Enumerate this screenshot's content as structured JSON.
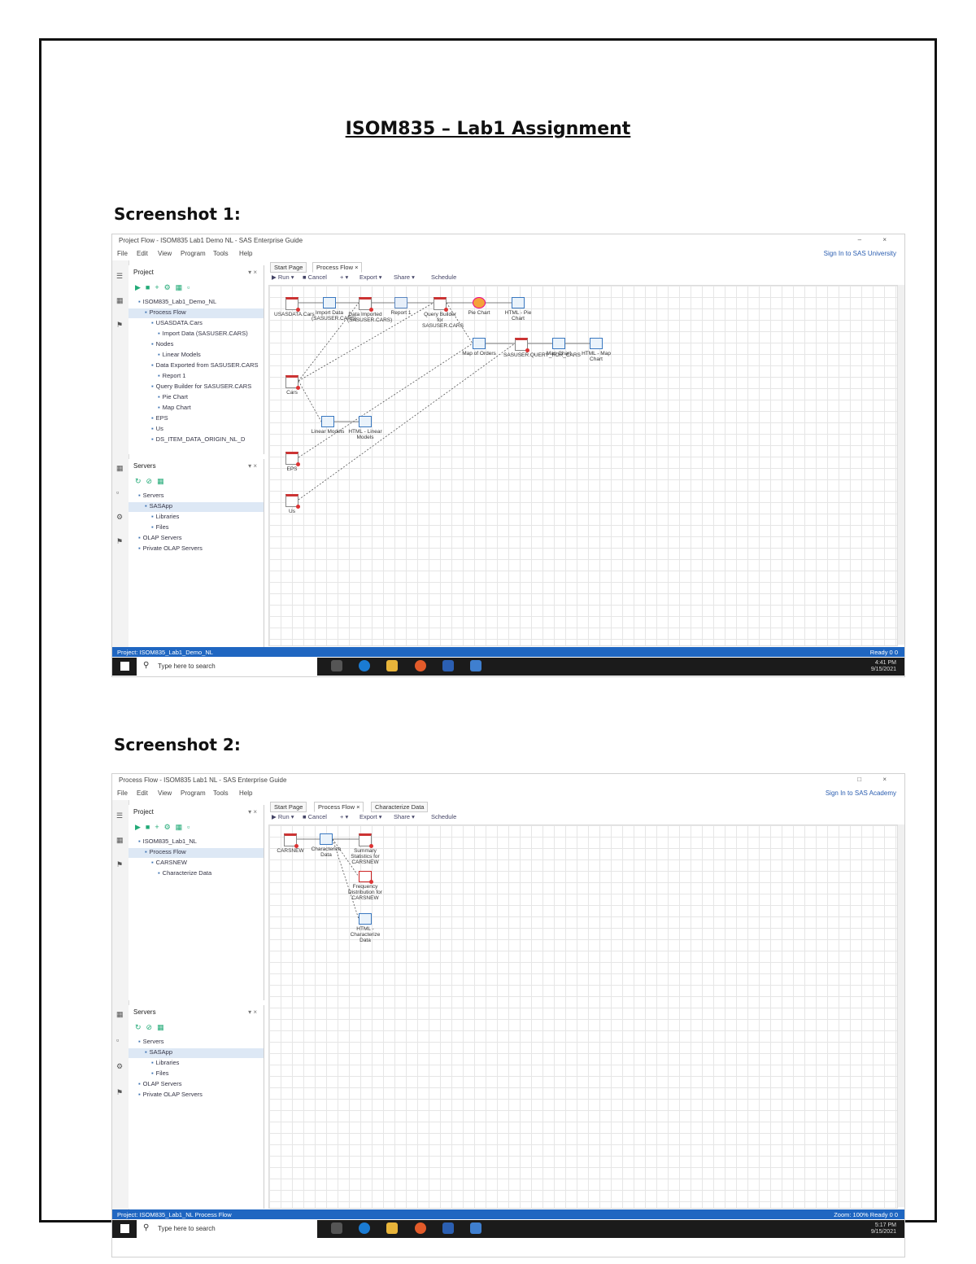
{
  "document": {
    "title": "ISOM835 – Lab1 Assignment",
    "captions": [
      "Screenshot 1:",
      "Screenshot 2:"
    ]
  },
  "shot1": {
    "window_title": "Project Flow - ISOM835 Lab1 Demo NL - SAS Enterprise Guide",
    "window_controls": "– ×",
    "menu": [
      "File",
      "Edit",
      "View",
      "Program",
      "Tools",
      "Help"
    ],
    "sign_in": "Sign In to SAS University",
    "project_panel": {
      "title": "Project",
      "close": "▾ ×"
    },
    "tree": [
      {
        "label": "ISOM835_Lab1_Demo_NL",
        "indent": 1
      },
      {
        "label": "Process Flow",
        "indent": 2,
        "selected": true
      },
      {
        "label": "USASDATA.Cars",
        "indent": 3
      },
      {
        "label": "Import Data (SASUSER.CARS)",
        "indent": 4
      },
      {
        "label": "Nodes",
        "indent": 3
      },
      {
        "label": "Linear Models",
        "indent": 4
      },
      {
        "label": "Data Exported from SASUSER.CARS",
        "indent": 3
      },
      {
        "label": "Report 1",
        "indent": 4
      },
      {
        "label": "Query Builder for SASUSER.CARS",
        "indent": 3
      },
      {
        "label": "Pie Chart",
        "indent": 4
      },
      {
        "label": "Map Chart",
        "indent": 4
      },
      {
        "label": "EPS",
        "indent": 3
      },
      {
        "label": "Us",
        "indent": 3
      },
      {
        "label": "DS_ITEM_DATA_ORIGIN_NL_D",
        "indent": 3
      }
    ],
    "servers_panel": {
      "title": "Servers",
      "close": "▾ ×"
    },
    "servers_tree": [
      {
        "label": "Servers",
        "indent": 1
      },
      {
        "label": "SASApp",
        "indent": 2,
        "selected": true
      },
      {
        "label": "Libraries",
        "indent": 3
      },
      {
        "label": "Files",
        "indent": 3
      },
      {
        "label": "OLAP Servers",
        "indent": 1
      },
      {
        "label": "Private OLAP Servers",
        "indent": 1
      }
    ],
    "tabs": [
      "Start Page",
      "Process Flow ×"
    ],
    "toolbar": [
      "▶ Run ▾",
      "■ Cancel",
      "+ ▾",
      "Export ▾",
      "Share ▾",
      "Schedule"
    ],
    "nodes": [
      {
        "label": "USASDATA.Cars",
        "icon": "data"
      },
      {
        "label": "Import Data (SASUSER.CARS)",
        "icon": "task"
      },
      {
        "label": "Data Imported (SASUSER.CARS)",
        "icon": "data"
      },
      {
        "label": "Report 1",
        "icon": "report"
      },
      {
        "label": "Query Builder for SASUSER.CARS",
        "icon": "data"
      },
      {
        "label": "Pie Chart",
        "icon": "chart"
      },
      {
        "label": "HTML - Pie Chart",
        "icon": "task"
      },
      {
        "label": "Map of Orders",
        "icon": "task"
      },
      {
        "label": "SASUSER.QUERY_FOR_CARS",
        "icon": "data"
      },
      {
        "label": "Map Chart",
        "icon": "task"
      },
      {
        "label": "HTML - Map Chart",
        "icon": "task"
      },
      {
        "label": "Cars",
        "icon": "data"
      },
      {
        "label": "Linear Models",
        "icon": "task"
      },
      {
        "label": "HTML - Linear Models",
        "icon": "task"
      },
      {
        "label": "EPS",
        "icon": "data"
      },
      {
        "label": "Us",
        "icon": "data"
      }
    ],
    "status_left": "Project: ISOM835_Lab1_Demo_NL",
    "status_right": "Ready   0  0",
    "taskbar": {
      "search": "Type here to search",
      "time": "4:41 PM",
      "date": "9/15/2021"
    }
  },
  "shot2": {
    "window_title": "Process Flow - ISOM835 Lab1 NL - SAS Enterprise Guide",
    "window_controls": "□ ×",
    "menu": [
      "File",
      "Edit",
      "View",
      "Program",
      "Tools",
      "Help"
    ],
    "sign_in": "Sign In to SAS Academy",
    "project_panel": {
      "title": "Project",
      "close": "▾ ×"
    },
    "tree": [
      {
        "label": "ISOM835_Lab1_NL",
        "indent": 1
      },
      {
        "label": "Process Flow",
        "indent": 2,
        "selected": true
      },
      {
        "label": "CARSNEW",
        "indent": 3
      },
      {
        "label": "Characterize Data",
        "indent": 4
      }
    ],
    "servers_panel": {
      "title": "Servers",
      "close": "▾ ×"
    },
    "servers_tree": [
      {
        "label": "Servers",
        "indent": 1
      },
      {
        "label": "SASApp",
        "indent": 2,
        "selected": true
      },
      {
        "label": "Libraries",
        "indent": 3
      },
      {
        "label": "Files",
        "indent": 3
      },
      {
        "label": "OLAP Servers",
        "indent": 1
      },
      {
        "label": "Private OLAP Servers",
        "indent": 1
      }
    ],
    "tabs": [
      "Start Page",
      "Process Flow ×",
      "Characterize Data"
    ],
    "toolbar": [
      "▶ Run ▾",
      "■ Cancel",
      "+ ▾",
      "Export ▾",
      "Share ▾",
      "Schedule"
    ],
    "nodes": [
      {
        "label": "CARSNEW",
        "icon": "data"
      },
      {
        "label": "Characterize Data",
        "icon": "task"
      },
      {
        "label": "Summary Statistics for CARSNEW",
        "icon": "data"
      },
      {
        "label": "Frequency Distribution for CARSNEW",
        "icon": "error"
      },
      {
        "label": "HTML - Characterize Data",
        "icon": "task"
      }
    ],
    "status_left": "Project: ISOM835_Lab1_NL    Process Flow",
    "status_right": "Zoom: 100%    Ready   0  0",
    "taskbar": {
      "search": "Type here to search",
      "time": "5:17 PM",
      "date": "9/15/2021"
    }
  }
}
